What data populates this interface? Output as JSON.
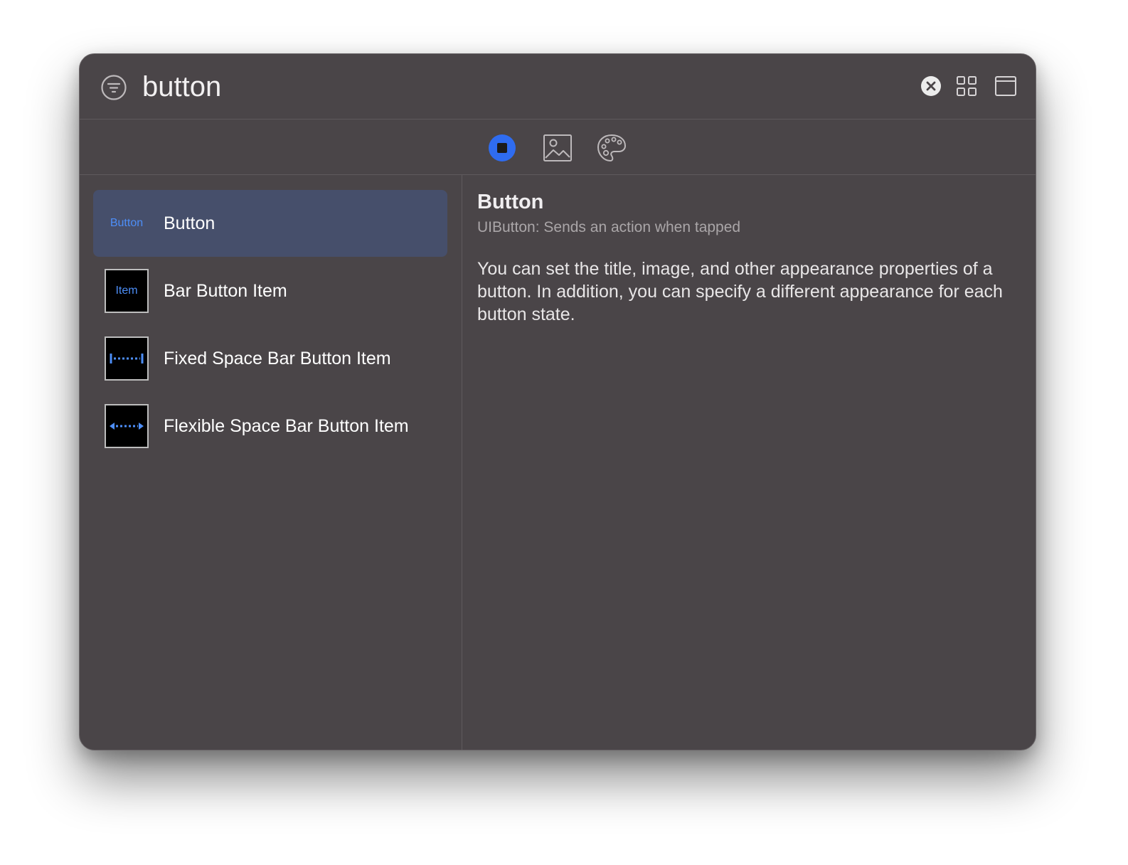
{
  "search": {
    "query": "button"
  },
  "toolbar": {
    "filter_icon": "filter-icon",
    "clear_icon": "clear-icon",
    "grid_icon": "grid-view-icon",
    "window_icon": "window-icon"
  },
  "segments": [
    {
      "name": "objects",
      "icon": "objects-icon",
      "selected": true
    },
    {
      "name": "media",
      "icon": "image-icon",
      "selected": false
    },
    {
      "name": "colors",
      "icon": "palette-icon",
      "selected": false
    }
  ],
  "library_items": [
    {
      "label": "Button",
      "thumb_text": "Button",
      "selected": true
    },
    {
      "label": "Bar Button Item",
      "thumb_text": "Item",
      "selected": false
    },
    {
      "label": "Fixed Space Bar Button Item",
      "thumb_icon": "fixed-space-icon",
      "selected": false
    },
    {
      "label": "Flexible Space Bar Button Item",
      "thumb_icon": "flexible-space-icon",
      "selected": false
    }
  ],
  "detail": {
    "title": "Button",
    "subtitle": "UIButton: Sends an action when tapped",
    "description": "You can set the title, image, and other appearance properties of a button. In addition, you can specify a different appearance for each button state."
  },
  "colors": {
    "window_bg": "#4a4548",
    "selection_bg": "#464f6b",
    "accent": "#2f6cf0",
    "thumb_accent": "#4d8ef7"
  }
}
